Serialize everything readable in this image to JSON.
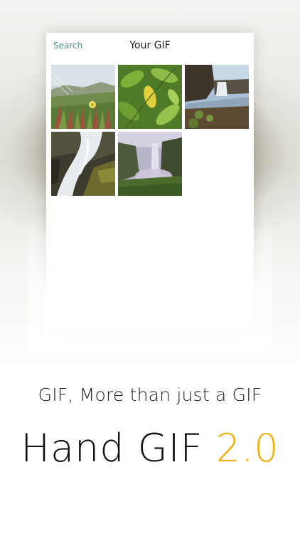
{
  "nav": {
    "back_label": "Search",
    "title": "Your GIF"
  },
  "gifs": [
    {
      "name": "gif-flowers-field",
      "scene": "coastal grass with yellow flower"
    },
    {
      "name": "gif-green-leaves",
      "scene": "green leaves with yellow leaf"
    },
    {
      "name": "gif-waterfall-cliff",
      "scene": "waterfall over rocky cliff"
    },
    {
      "name": "gif-cascade-rocks",
      "scene": "cascade over mossy rocks"
    },
    {
      "name": "gif-misty-waterfall",
      "scene": "misty waterfall canyon"
    }
  ],
  "promo": {
    "caption": "GIF, More than just a GIF",
    "headline_name": "Hand GIF",
    "headline_version": "2.0"
  },
  "colors": {
    "accent": "#f2b10f",
    "link": "#4f8f8a"
  }
}
